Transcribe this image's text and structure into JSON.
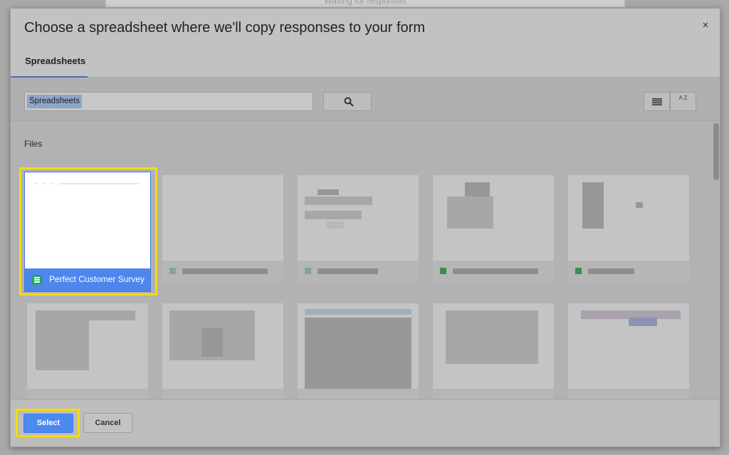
{
  "background": {
    "status_text": "Waiting for responses"
  },
  "dialog": {
    "title": "Choose a spreadsheet where we'll copy responses to your form",
    "close_label": "×",
    "tabs": [
      {
        "label": "Spreadsheets",
        "active": true
      }
    ]
  },
  "toolbar": {
    "search_chip": "Spreadsheets",
    "search_icon": "search-icon",
    "list_view_icon": "list-view-icon",
    "sort_label": "A Z"
  },
  "files": {
    "label": "Files",
    "selected_file": {
      "name": "Perfect Customer Survey",
      "icon": "google-sheets-icon"
    }
  },
  "footer": {
    "select_label": "Select",
    "cancel_label": "Cancel"
  },
  "colors": {
    "accent": "#4d8af0",
    "highlight": "#f2de00",
    "sheets_green": "#1fa463"
  }
}
